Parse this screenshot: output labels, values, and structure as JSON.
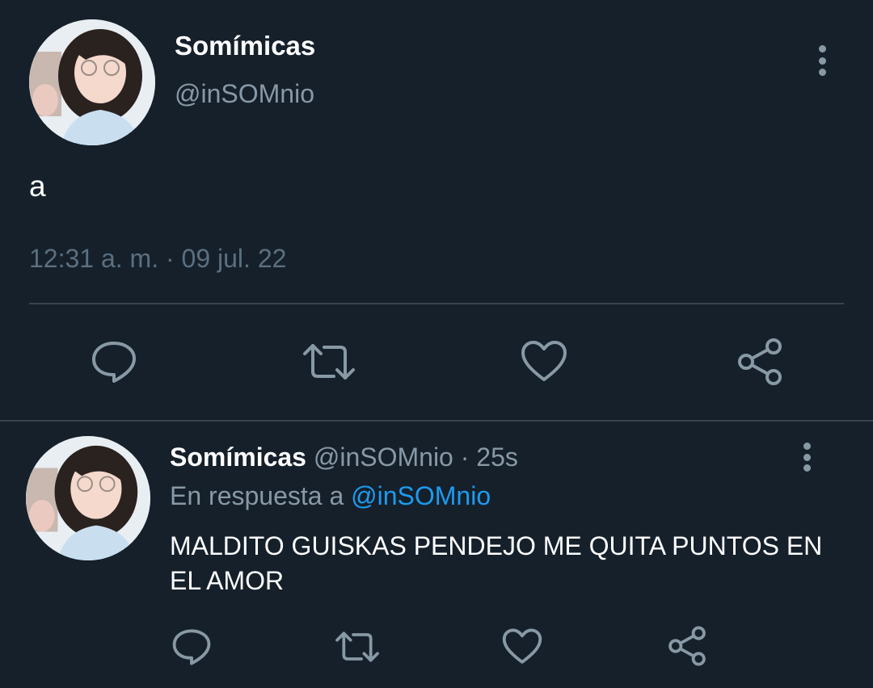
{
  "main_tweet": {
    "display_name": "Somímicas",
    "handle": "@inSOMnio",
    "text": "a",
    "timestamp": "12:31 a. m. · 09 jul. 22",
    "actions": [
      "reply-icon",
      "retweet-icon",
      "like-icon",
      "share-icon"
    ]
  },
  "reply_tweet": {
    "display_name": "Somímicas",
    "meta": "@inSOMnio · 25s",
    "reply_prefix": "En respuesta a",
    "reply_mention": "@inSOMnio",
    "text": "MALDITO GUISKAS PENDEJO ME QUITA PUNTOS EN EL AMOR",
    "actions": [
      "reply-icon",
      "retweet-icon",
      "like-icon",
      "share-icon"
    ]
  },
  "colors": {
    "background": "#15202b",
    "primary_text": "#ffffff",
    "secondary_text": "#8899a6",
    "divider": "#38444d",
    "accent": "#1d9bf0"
  }
}
